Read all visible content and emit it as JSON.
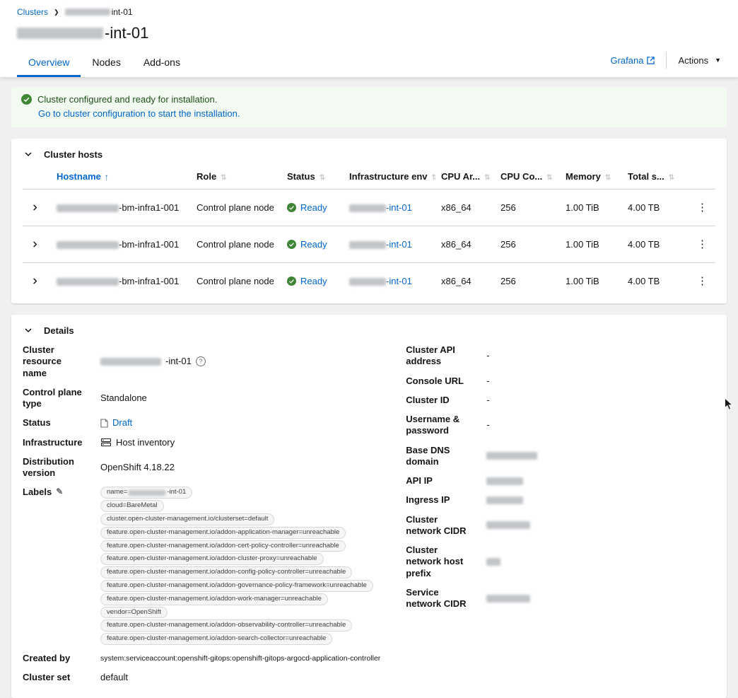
{
  "breadcrumb": {
    "clusters": "Clusters",
    "current_suffix": "int-01"
  },
  "header": {
    "title_suffix": "-int-01",
    "grafana": "Grafana",
    "actions": "Actions"
  },
  "tabs": {
    "overview": "Overview",
    "nodes": "Nodes",
    "addons": "Add-ons"
  },
  "alert": {
    "title": "Cluster configured and ready for installation.",
    "link": "Go to cluster configuration to start the installation."
  },
  "hosts": {
    "section_title": "Cluster hosts",
    "columns": {
      "hostname": "Hostname",
      "role": "Role",
      "status": "Status",
      "infra_env": "Infrastructure env",
      "cpu_arch": "CPU Ar...",
      "cpu_count": "CPU Co...",
      "memory": "Memory",
      "total_storage": "Total s..."
    },
    "rows": [
      {
        "hostname_suffix": "-bm-infra1-001",
        "role": "Control plane node",
        "status": "Ready",
        "infra_suffix": "-int-01",
        "cpu_arch": "x86_64",
        "cpu_count": "256",
        "memory": "1.00 TiB",
        "total_storage": "4.00 TB"
      },
      {
        "hostname_suffix": "-bm-infra1-001",
        "role": "Control plane node",
        "status": "Ready",
        "infra_suffix": "-int-01",
        "cpu_arch": "x86_64",
        "cpu_count": "256",
        "memory": "1.00 TiB",
        "total_storage": "4.00 TB"
      },
      {
        "hostname_suffix": "-bm-infra1-001",
        "role": "Control plane node",
        "status": "Ready",
        "infra_suffix": "-int-01",
        "cpu_arch": "x86_64",
        "cpu_count": "256",
        "memory": "1.00 TiB",
        "total_storage": "4.00 TB"
      }
    ]
  },
  "details": {
    "section_title": "Details",
    "left": {
      "resource_name_label": "Cluster resource name",
      "resource_name_suffix": "-int-01",
      "control_plane_label": "Control plane type",
      "control_plane_value": "Standalone",
      "status_label": "Status",
      "status_value": "Draft",
      "infrastructure_label": "Infrastructure",
      "infrastructure_value": "Host inventory",
      "distribution_label": "Distribution version",
      "distribution_value": "OpenShift 4.18.22",
      "labels_label": "Labels",
      "created_by_label": "Created by",
      "created_by_value": "system:serviceaccount:openshift-gitops:openshift-gitops-argocd-application-controller",
      "cluster_set_label": "Cluster set",
      "cluster_set_value": "default"
    },
    "labels": [
      {
        "prefix": "name=",
        "suffix": "-int-01"
      },
      {
        "text": "cloud=BareMetal"
      },
      {
        "text": "cluster.open-cluster-management.io/clusterset=default"
      },
      {
        "text": "feature.open-cluster-management.io/addon-application-manager=unreachable"
      },
      {
        "text": "feature.open-cluster-management.io/addon-cert-policy-controller=unreachable"
      },
      {
        "text": "feature.open-cluster-management.io/addon-cluster-proxy=unreachable"
      },
      {
        "text": "feature.open-cluster-management.io/addon-config-policy-controller=unreachable"
      },
      {
        "text": "feature.open-cluster-management.io/addon-governance-policy-framework=unreachable"
      },
      {
        "text": "feature.open-cluster-management.io/addon-work-manager=unreachable"
      },
      {
        "text": "vendor=OpenShift"
      },
      {
        "text": "feature.open-cluster-management.io/addon-observability-controller=unreachable"
      },
      {
        "text": "feature.open-cluster-management.io/addon-search-collector=unreachable"
      }
    ],
    "right": {
      "api_address_label": "Cluster API address",
      "api_address_value": "-",
      "console_url_label": "Console URL",
      "console_url_value": "-",
      "cluster_id_label": "Cluster ID",
      "cluster_id_value": "-",
      "credentials_label": "Username & password",
      "credentials_value": "-",
      "base_dns_label": "Base DNS domain",
      "api_ip_label": "API IP",
      "ingress_ip_label": "Ingress IP",
      "network_cidr_label": "Cluster network CIDR",
      "host_prefix_label": "Cluster network host prefix",
      "service_cidr_label": "Service network CIDR"
    }
  }
}
